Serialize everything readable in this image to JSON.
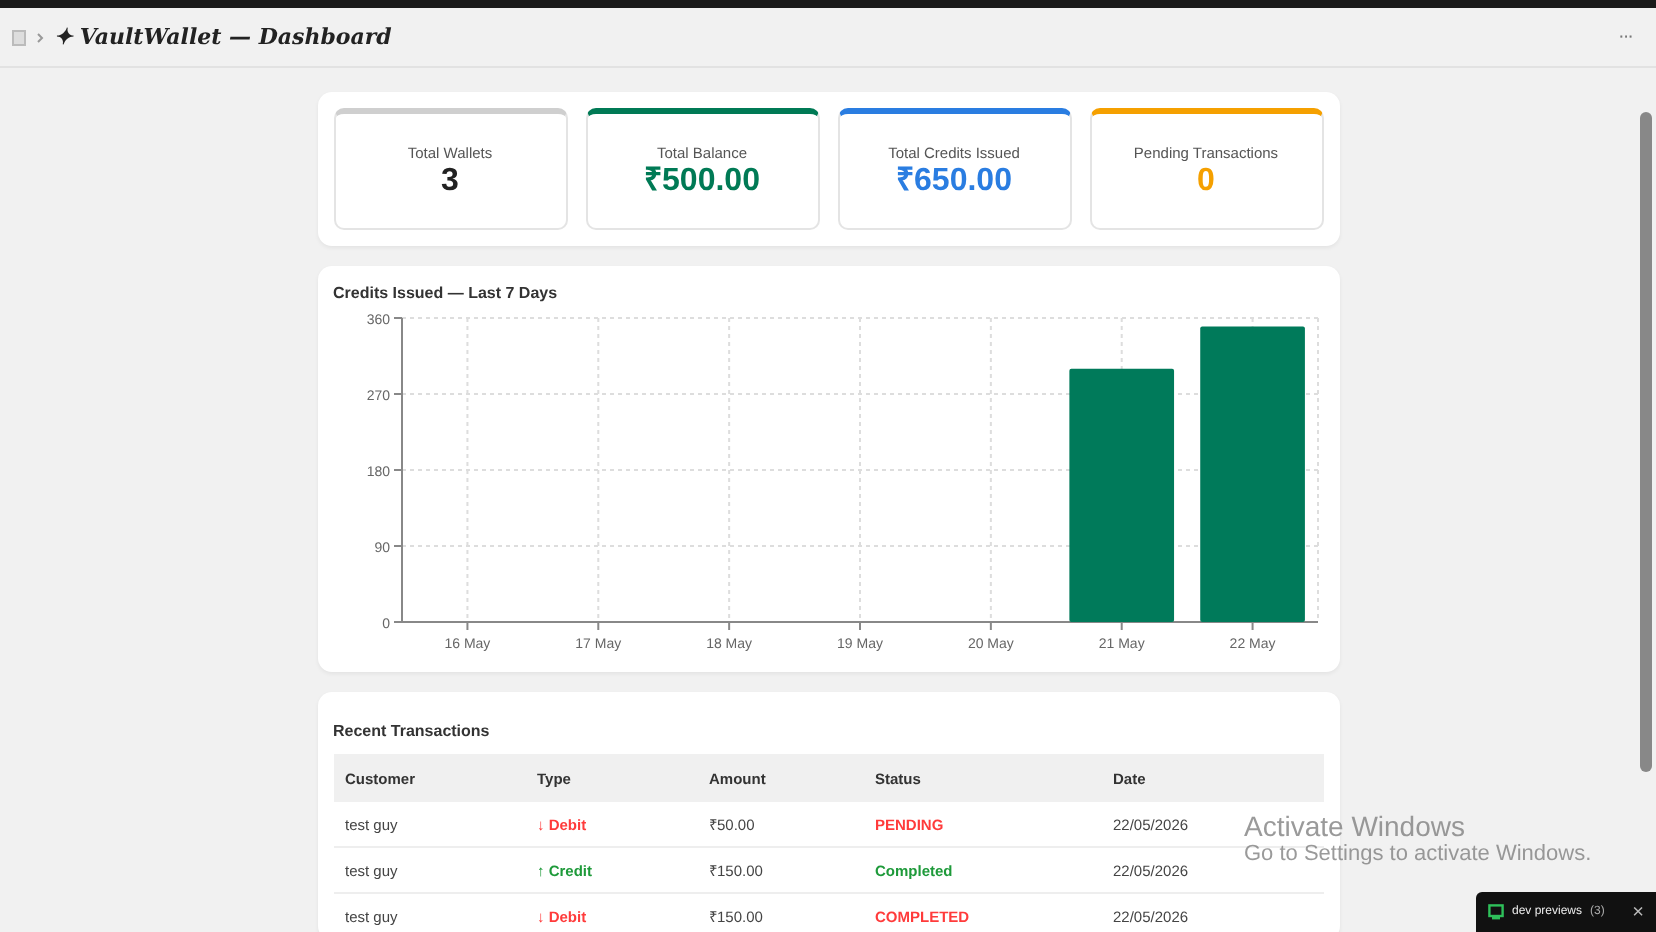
{
  "header": {
    "title": "✦ VaultWallet — Dashboard",
    "menu": "···"
  },
  "stats": [
    {
      "label": "Total Wallets",
      "value": "3",
      "color": "#222222"
    },
    {
      "label": "Total Balance",
      "value": "₹500.00",
      "color": "#007a55"
    },
    {
      "label": "Total Credits Issued",
      "value": "₹650.00",
      "color": "#2a7de1"
    },
    {
      "label": "Pending Transactions",
      "value": "0",
      "color": "#f5a000"
    }
  ],
  "chart": {
    "chart_data": {
      "type": "bar",
      "title": "Credits Issued — Last 7 Days",
      "categories": [
        "16 May",
        "17 May",
        "18 May",
        "19 May",
        "20 May",
        "21 May",
        "22 May"
      ],
      "values": [
        0,
        0,
        0,
        0,
        0,
        300,
        350
      ],
      "ylim": [
        0,
        360
      ],
      "yticks": [
        0,
        90,
        180,
        270,
        360
      ],
      "grid": true
    }
  },
  "transactions": {
    "title": "Recent Transactions",
    "columns": [
      "Customer",
      "Type",
      "Amount",
      "Status",
      "Date"
    ],
    "rows": [
      {
        "kind": "debit",
        "customer": "test guy",
        "type": "↓ Debit",
        "amount": "₹50.00",
        "status": "PENDING",
        "color": "#ff3b3b",
        "date": "22/05/2026"
      },
      {
        "kind": "credit",
        "customer": "test guy",
        "type": "↑ Credit",
        "amount": "₹150.00",
        "status": "Completed",
        "color": "#1e9a3a",
        "date": "22/05/2026"
      },
      {
        "kind": "debit",
        "customer": "test guy",
        "type": "↓ Debit",
        "amount": "₹150.00",
        "status": "COMPLETED",
        "color": "#ff3b3b",
        "date": "22/05/2026"
      }
    ]
  },
  "os_notice": {
    "title": "Activate Windows",
    "text": "Go to Settings to activate Windows."
  },
  "toast": {
    "label": "dev previews",
    "count": "(3)",
    "close": "×"
  }
}
